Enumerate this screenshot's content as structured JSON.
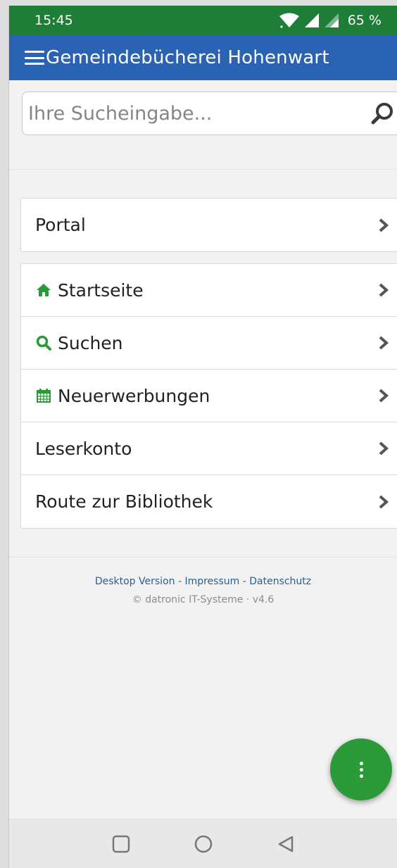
{
  "status_bar": {
    "time": "15:45",
    "battery": "65 %",
    "icons": [
      "wifi-icon",
      "signal-icon",
      "signal-weak-icon"
    ]
  },
  "app_bar": {
    "menu_icon": "hamburger-menu-icon",
    "title": "Gemeindebücherei Hohenwart"
  },
  "search": {
    "placeholder": "Ihre Sucheingabe...",
    "value": "",
    "icon": "search-icon"
  },
  "portal": {
    "label": "Portal"
  },
  "nav": {
    "items": [
      {
        "label": "Startseite",
        "icon": "home-icon",
        "icon_color": "#2d9a39"
      },
      {
        "label": "Suchen",
        "icon": "search-icon",
        "icon_color": "#2d9a39"
      },
      {
        "label": "Neuerwerbungen",
        "icon": "calendar-icon",
        "icon_color": "#2d9a39"
      },
      {
        "label": "Leserkonto",
        "icon": ""
      },
      {
        "label": "Route zur Bibliothek",
        "icon": ""
      }
    ]
  },
  "footer": {
    "desktop_link": "Desktop Version",
    "impressum_link": "Impressum",
    "datenschutz_link": "Datenschutz",
    "separator": " - ",
    "copyright": "© datronic IT-Systeme · v4.6"
  },
  "fab": {
    "icon": "more-vertical-icon",
    "color": "#2d9a39"
  },
  "nav_bar": {
    "icons": [
      "square-recents-icon",
      "circle-home-icon",
      "triangle-back-icon"
    ]
  },
  "colors": {
    "status_bar": "#1e7d36",
    "app_bar": "#2b63b4",
    "accent": "#2d9a39",
    "link": "#2a5e8e"
  }
}
